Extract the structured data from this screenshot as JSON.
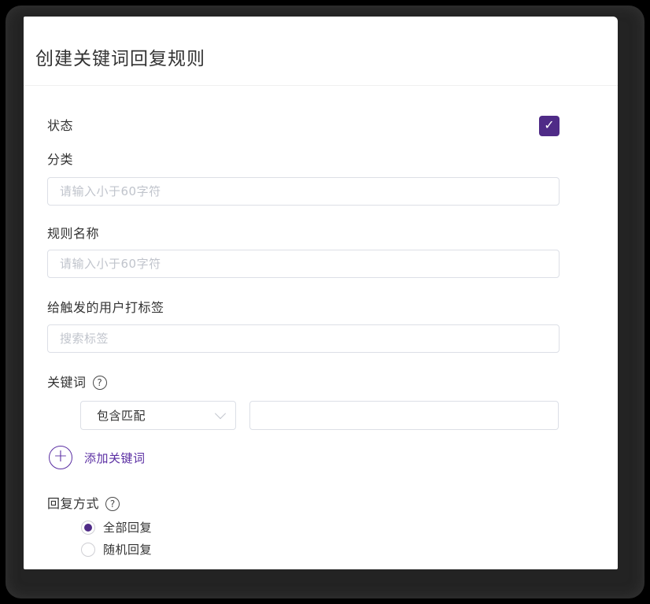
{
  "dialog": {
    "title": "创建关键词回复规则",
    "status": {
      "label": "状态",
      "checked": true
    },
    "category": {
      "label": "分类",
      "placeholder": "请输入小于60字符",
      "value": ""
    },
    "rule_name": {
      "label": "规则名称",
      "placeholder": "请输入小于60字符",
      "value": ""
    },
    "tag": {
      "label": "给触发的用户打标签",
      "placeholder": "搜索标签",
      "value": ""
    },
    "keyword": {
      "label": "关键词",
      "match_type_selected": "包含匹配",
      "keyword_value": "",
      "add_button_label": "添加关键词"
    },
    "reply_mode": {
      "label": "回复方式",
      "options": [
        {
          "label": "全部回复",
          "selected": true
        },
        {
          "label": "随机回复",
          "selected": false
        }
      ]
    },
    "icons": {
      "checkmark": "✓",
      "help": "?",
      "plus": "+"
    },
    "colors": {
      "accent_purple": "#4f2b87",
      "link_purple": "#5b2fa3",
      "input_border": "#dcdfe6",
      "placeholder_gray": "#c0c4cc"
    }
  }
}
